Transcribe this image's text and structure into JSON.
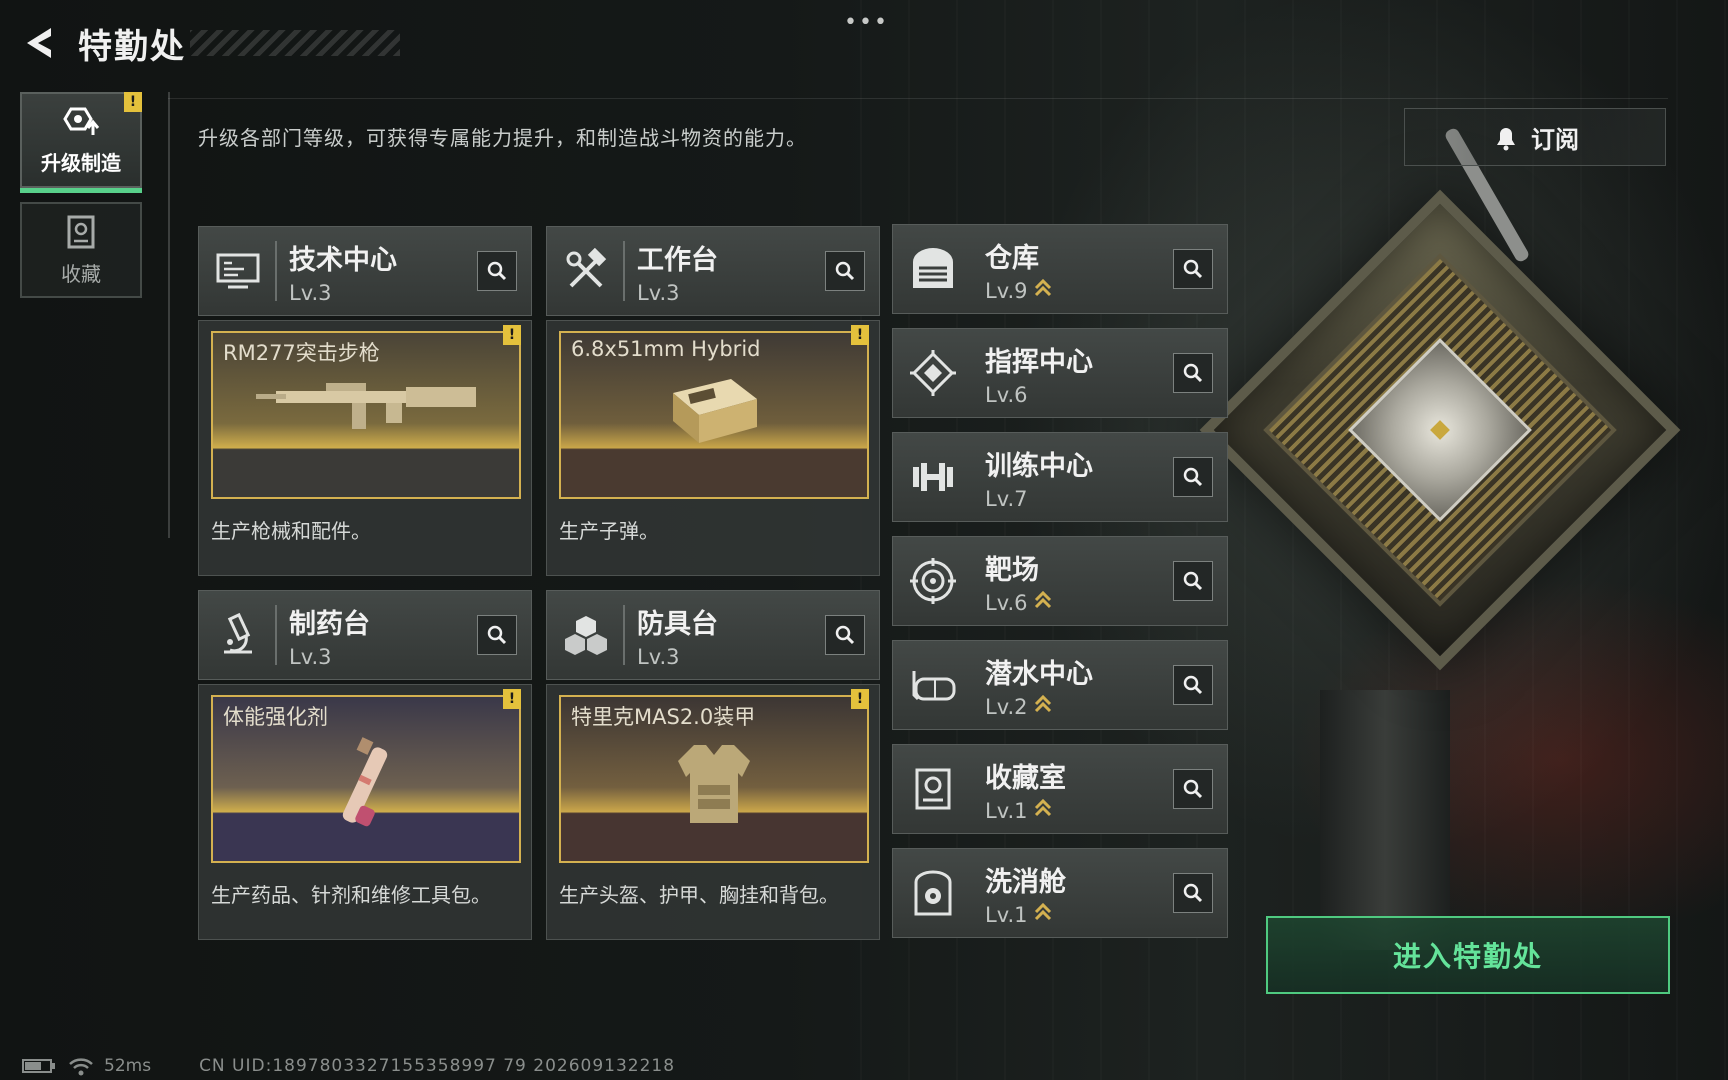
{
  "header": {
    "title": "特勤处",
    "menu_dots": "•••"
  },
  "sidebar": {
    "tabs": [
      {
        "label": "升级制造",
        "active": true,
        "alert": "!"
      },
      {
        "label": "收藏",
        "active": false
      }
    ]
  },
  "description": "升级各部门等级，可获得专属能力提升，和制造战斗物资的能力。",
  "subscribe": {
    "label": "订阅"
  },
  "production_departments": [
    {
      "name": "技术中心",
      "level": "Lv.3",
      "icon": "monitor-icon",
      "product": "RM277突击步枪",
      "alert": "!",
      "description": "生产枪械和配件。"
    },
    {
      "name": "工作台",
      "level": "Lv.3",
      "icon": "tools-icon",
      "product": "6.8x51mm Hybrid",
      "alert": "!",
      "description": "生产子弹。"
    },
    {
      "name": "制药台",
      "level": "Lv.3",
      "icon": "microscope-icon",
      "product": "体能强化剂",
      "alert": "!",
      "description": "生产药品、针剂和维修工具包。"
    },
    {
      "name": "防具台",
      "level": "Lv.3",
      "icon": "armor-blocks-icon",
      "product": "特里克MAS2.0装甲",
      "alert": "!",
      "description": "生产头盔、护甲、胸挂和背包。"
    }
  ],
  "facilities": [
    {
      "name": "仓库",
      "level": "Lv.9",
      "upgradable": true,
      "icon": "warehouse-icon"
    },
    {
      "name": "指挥中心",
      "level": "Lv.6",
      "upgradable": false,
      "icon": "command-chip-icon"
    },
    {
      "name": "训练中心",
      "level": "Lv.7",
      "upgradable": false,
      "icon": "dumbbell-icon"
    },
    {
      "name": "靶场",
      "level": "Lv.6",
      "upgradable": true,
      "icon": "target-icon"
    },
    {
      "name": "潜水中心",
      "level": "Lv.2",
      "upgradable": true,
      "icon": "diving-mask-icon"
    },
    {
      "name": "收藏室",
      "level": "Lv.1",
      "upgradable": true,
      "icon": "collection-icon"
    },
    {
      "name": "洗消舱",
      "level": "Lv.1",
      "upgradable": true,
      "icon": "decontamination-icon"
    }
  ],
  "enter_button": {
    "label": "进入特勤处"
  },
  "status_bar": {
    "ping": "52ms",
    "uid": "CN UID:1897803327155358997 79 202609132218"
  },
  "colors": {
    "accent_green": "#58d08a",
    "gold": "#d4b150",
    "alert_yellow": "#e4c13c"
  }
}
